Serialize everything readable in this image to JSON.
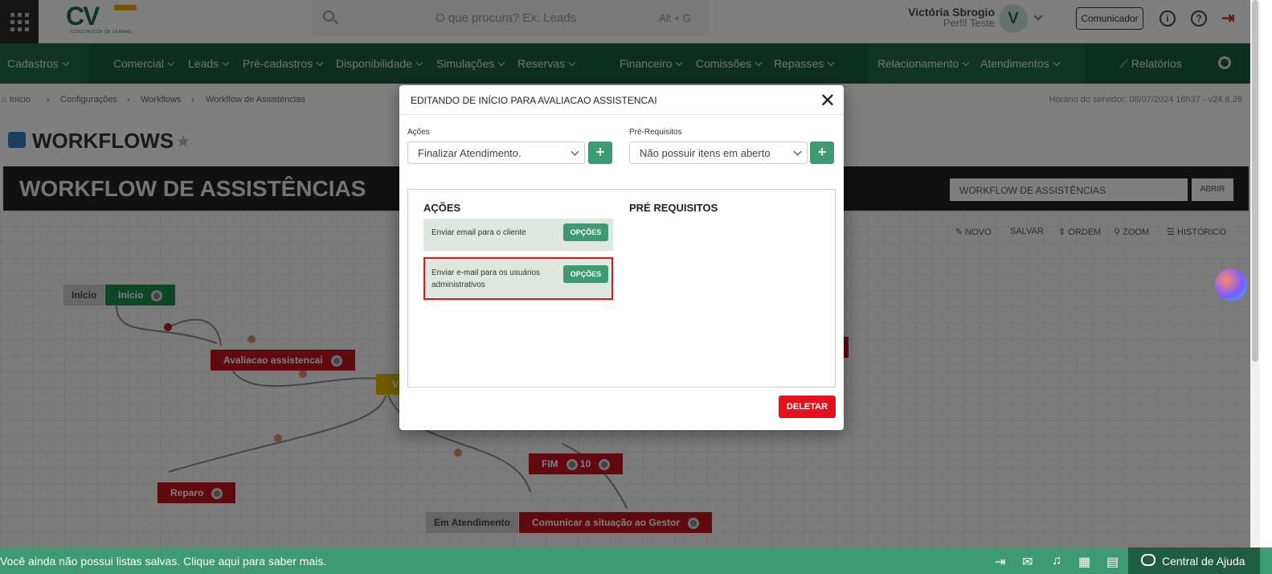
{
  "header": {
    "logo_text": "CV",
    "logo_sub": "CONSTRUTOR DE VENDAS",
    "search_placeholder": "O que procura? Ex: Leads",
    "search_shortcut": "Alt + G",
    "user_name": "Victória Sbrogio",
    "user_profile": "Perfil Teste",
    "avatar_letter": "V",
    "comunicador_label": "Comunicador",
    "info_icon": "i",
    "help_icon": "?",
    "logout_icon": "⇥"
  },
  "nav": {
    "items": [
      {
        "label": "Cadastros"
      },
      {
        "label": "Comercial"
      },
      {
        "label": "Leads"
      },
      {
        "label": "Pré-cadastros"
      },
      {
        "label": "Disponibilidade"
      },
      {
        "label": "Simulações"
      },
      {
        "label": "Reservas"
      },
      {
        "label": "Financeiro"
      },
      {
        "label": "Comissões"
      },
      {
        "label": "Repasses"
      },
      {
        "label": "Relacionamento"
      },
      {
        "label": "Atendimentos"
      }
    ],
    "reports_label": "Relatórios"
  },
  "breadcrumb": {
    "items": [
      "Início",
      "Configurações",
      "Workflows",
      "Workflow de Assistências"
    ],
    "server_time": "Horário do servidor: 08/07/2024 16h37 - v24.6.28"
  },
  "page": {
    "title": "WORKFLOWS",
    "band_title": "WORKFLOW DE ASSISTÊNCIAS",
    "band_select": "WORKFLOW DE ASSISTÊNCIAS",
    "band_button": "ABRIR",
    "tools": [
      "NOVO",
      "SALVAR",
      "ORDEM",
      "ZOOM",
      "HISTÓRICO"
    ]
  },
  "workflow_nodes": {
    "inicio_tag": "Início",
    "inicio": "Início",
    "avaliacao": "Avaliacao assistencai",
    "reparo": "Reparo",
    "fim": "FIM",
    "fim_count": "10",
    "em_atendimento": "Em Atendimento",
    "comunicar": "Comunicar a situação ao Gestor",
    "partial": "V"
  },
  "modal": {
    "title": "EDITANDO DE INÍCIO PARA AVALIACAO ASSISTENCAI",
    "acoes_label": "Ações",
    "acoes_value": "Finalizar Atendimento.",
    "pre_label": "Pré-Requisitos",
    "pre_value": "Não possuir itens em aberto",
    "plus": "+",
    "acoes_heading": "AÇÕES",
    "pre_heading": "PRÉ REQUISITOS",
    "actions": [
      {
        "text": "Enviar email para o cliente",
        "button": "OPÇÕES"
      },
      {
        "text": "Enviar e-mail para os usuários administrativos",
        "button": "OPÇÕES"
      }
    ],
    "delete_label": "DELETAR"
  },
  "footer": {
    "message": "Você ainda não possui listas salvas. Clique aqui para saber mais.",
    "help_label": "Central de Ajuda"
  }
}
